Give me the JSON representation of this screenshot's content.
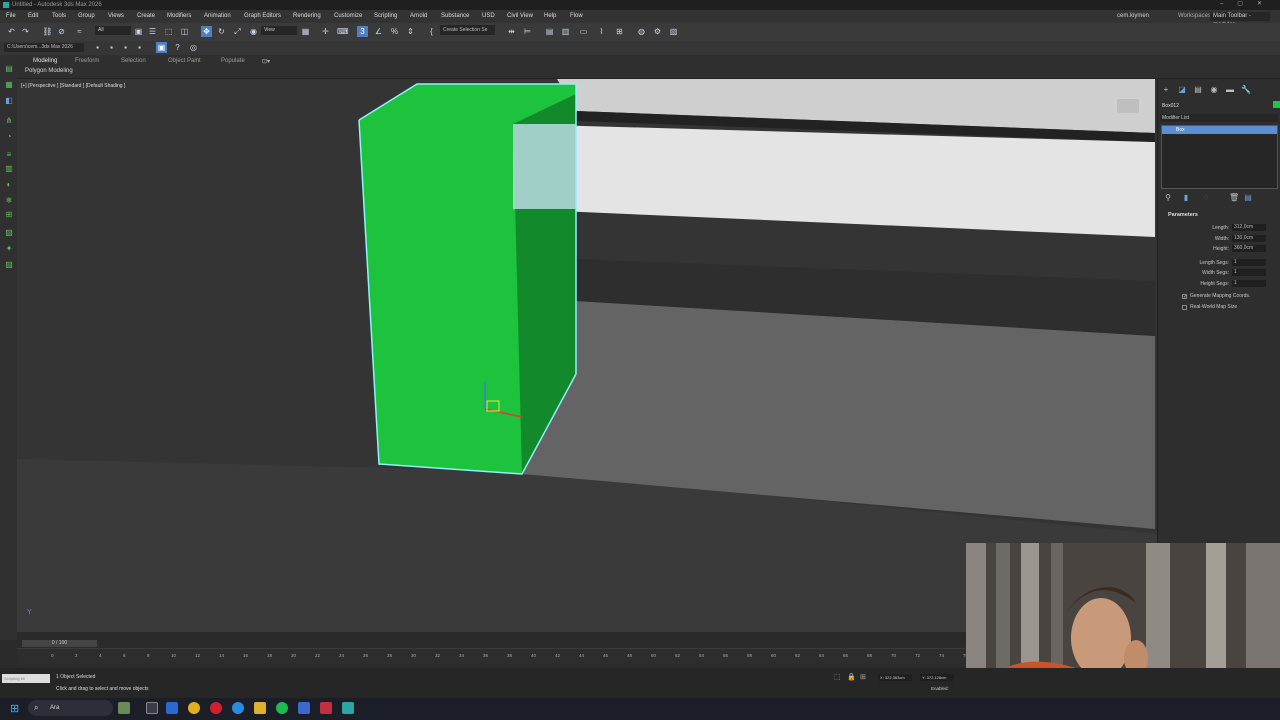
{
  "window": {
    "title": "Untitled - Autodesk 3ds Max 2026",
    "controls": [
      "–",
      "▢",
      "✕"
    ]
  },
  "menu": {
    "items": [
      "File",
      "Edit",
      "Tools",
      "Group",
      "Views",
      "Create",
      "Modifiers",
      "Animation",
      "Graph Editors",
      "Rendering",
      "Customize",
      "Scripting",
      "Arnold",
      "Substance",
      "USD",
      "Civil View",
      "Help",
      "Flow"
    ],
    "user": "cem.kiymen",
    "workspaces_label": "Workspaces:",
    "workspace_value": "Main Toolbar - modular"
  },
  "toolbar": {
    "selection_filter": "All",
    "ref_coord": "View",
    "create_selection_set": "Create Selection Se",
    "project_path": "C:\\Users\\cem...3ds Max 2026"
  },
  "ribbon": {
    "tabs": [
      "Modeling",
      "Freeform",
      "Selection",
      "Object Paint",
      "Populate"
    ],
    "active_tab": "Modeling",
    "panel_label": "Polygon Modeling"
  },
  "viewport": {
    "label": "[+] [Perspective ] [Standard ] [Default Shading ]",
    "axis_label": "Y",
    "colors": {
      "selected_box": "#1fbf3e",
      "highlight_edge": "#7fe6ff",
      "grey_surface": "#a8a8a8"
    }
  },
  "command_panel": {
    "object_name": "Box012",
    "object_color": "#19c94a",
    "modifier_list": "Modifier List",
    "stack_item": "Box",
    "parameters_title": "Parameters",
    "params": [
      {
        "label": "Length:",
        "value": "312,0cm"
      },
      {
        "label": "Width:",
        "value": "130,0cm"
      },
      {
        "label": "Height:",
        "value": "360,0cm"
      }
    ],
    "segs": [
      {
        "label": "Length Segs:",
        "value": "1"
      },
      {
        "label": "Width Segs:",
        "value": "1"
      },
      {
        "label": "Height Segs:",
        "value": "1"
      }
    ],
    "checks": [
      {
        "label": "Generate Mapping Coords.",
        "checked": true
      },
      {
        "label": "Real-World Map Size",
        "checked": false
      }
    ]
  },
  "timeline": {
    "frame_indicator": "0 / 100",
    "ticks": [
      "0",
      "2",
      "4",
      "6",
      "8",
      "10",
      "12",
      "14",
      "16",
      "18",
      "20",
      "22",
      "24",
      "26",
      "28",
      "30",
      "32",
      "34",
      "36",
      "38",
      "40",
      "42",
      "44",
      "46",
      "48",
      "50",
      "52",
      "54",
      "56",
      "58",
      "60",
      "62",
      "64",
      "66",
      "68",
      "70",
      "72",
      "74",
      "76",
      "78"
    ]
  },
  "status": {
    "script_box": "Scripting Mi",
    "selected": "1 Object Selected",
    "hint": "Click and drag to select and move objects",
    "x_coord": "X: 322,363cm",
    "y_coord": "Y: 372,128cm",
    "enabled": "Enabled:"
  },
  "taskbar": {
    "search": "Ara"
  }
}
